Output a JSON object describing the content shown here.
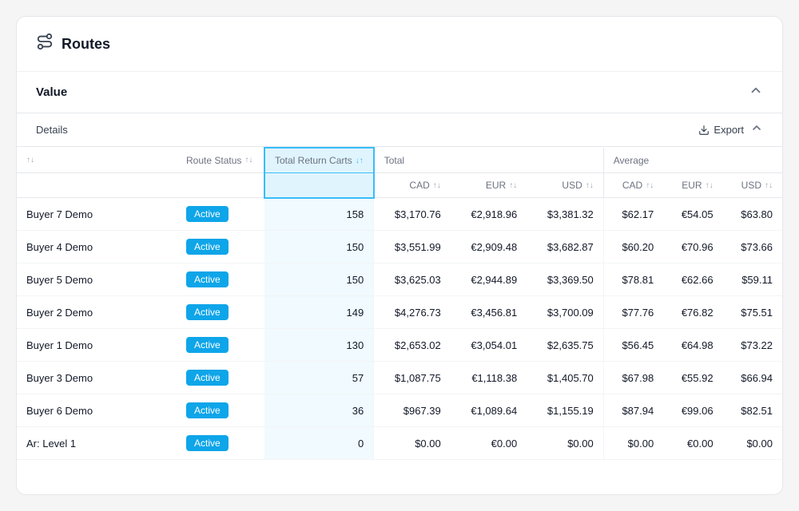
{
  "app": {
    "title": "Routes",
    "icon": "routes-icon"
  },
  "section": {
    "title": "Value",
    "collapse_label": "collapse"
  },
  "details": {
    "label": "Details",
    "export_label": "Export"
  },
  "table": {
    "col_headers": {
      "name_sort": "↑↓",
      "route_status": "Route Status",
      "total_return_carts": "Total Return Carts",
      "total": "Total",
      "average": "Average"
    },
    "sub_headers": {
      "cad": "CAD",
      "eur": "EUR",
      "usd": "USD"
    },
    "rows": [
      {
        "name": "Buyer 7 Demo",
        "status": "Active",
        "return_carts": "158",
        "total_cad": "$3,170.76",
        "total_eur": "€2,918.96",
        "total_usd": "$3,381.32",
        "avg_cad": "$62.17",
        "avg_eur": "€54.05",
        "avg_usd": "$63.80"
      },
      {
        "name": "Buyer 4 Demo",
        "status": "Active",
        "return_carts": "150",
        "total_cad": "$3,551.99",
        "total_eur": "€2,909.48",
        "total_usd": "$3,682.87",
        "avg_cad": "$60.20",
        "avg_eur": "€70.96",
        "avg_usd": "$73.66"
      },
      {
        "name": "Buyer 5 Demo",
        "status": "Active",
        "return_carts": "150",
        "total_cad": "$3,625.03",
        "total_eur": "€2,944.89",
        "total_usd": "$3,369.50",
        "avg_cad": "$78.81",
        "avg_eur": "€62.66",
        "avg_usd": "$59.11"
      },
      {
        "name": "Buyer 2 Demo",
        "status": "Active",
        "return_carts": "149",
        "total_cad": "$4,276.73",
        "total_eur": "€3,456.81",
        "total_usd": "$3,700.09",
        "avg_cad": "$77.76",
        "avg_eur": "€76.82",
        "avg_usd": "$75.51"
      },
      {
        "name": "Buyer 1 Demo",
        "status": "Active",
        "return_carts": "130",
        "total_cad": "$2,653.02",
        "total_eur": "€3,054.01",
        "total_usd": "$2,635.75",
        "avg_cad": "$56.45",
        "avg_eur": "€64.98",
        "avg_usd": "$73.22"
      },
      {
        "name": "Buyer 3 Demo",
        "status": "Active",
        "return_carts": "57",
        "total_cad": "$1,087.75",
        "total_eur": "€1,118.38",
        "total_usd": "$1,405.70",
        "avg_cad": "$67.98",
        "avg_eur": "€55.92",
        "avg_usd": "$66.94"
      },
      {
        "name": "Buyer 6 Demo",
        "status": "Active",
        "return_carts": "36",
        "total_cad": "$967.39",
        "total_eur": "€1,089.64",
        "total_usd": "$1,155.19",
        "avg_cad": "$87.94",
        "avg_eur": "€99.06",
        "avg_usd": "$82.51"
      },
      {
        "name": "Ar: Level 1",
        "status": "Active",
        "return_carts": "0",
        "total_cad": "$0.00",
        "total_eur": "€0.00",
        "total_usd": "$0.00",
        "avg_cad": "$0.00",
        "avg_eur": "€0.00",
        "avg_usd": "$0.00"
      }
    ]
  }
}
